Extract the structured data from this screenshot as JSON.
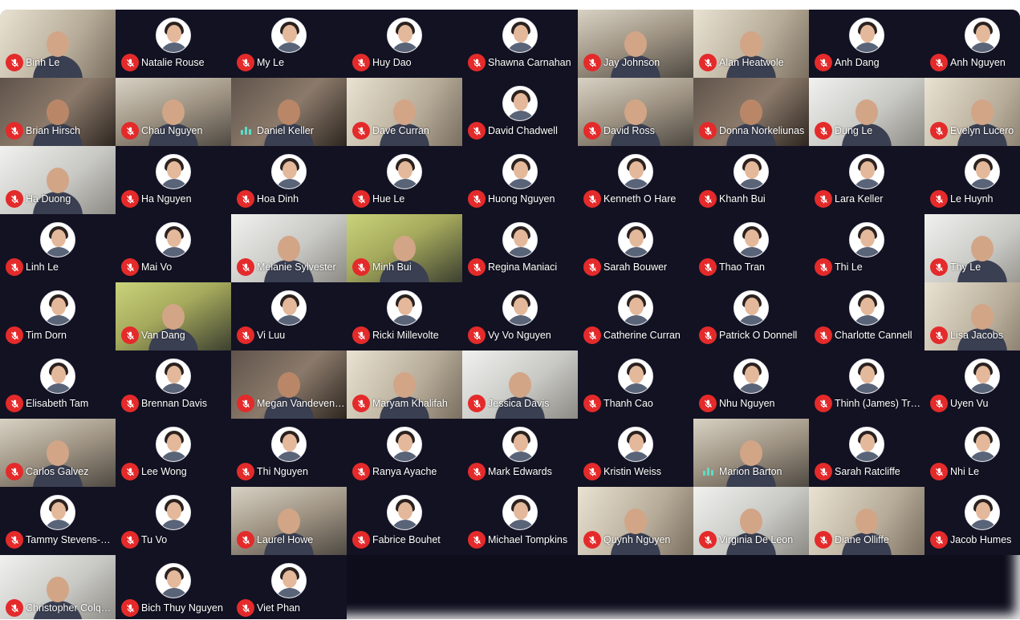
{
  "participants": [
    {
      "name": "Binh Le",
      "video": true,
      "style": "alt2",
      "speaking": false
    },
    {
      "name": "Natalie Rouse",
      "video": false,
      "speaking": false
    },
    {
      "name": "My Le",
      "video": false,
      "speaking": false
    },
    {
      "name": "Huy Dao",
      "video": false,
      "speaking": false
    },
    {
      "name": "Shawna Carnahan",
      "video": false,
      "speaking": false
    },
    {
      "name": "Jay Johnson",
      "video": true,
      "style": "alt1",
      "speaking": false
    },
    {
      "name": "Alan Heatwole",
      "video": true,
      "style": "alt2",
      "speaking": false
    },
    {
      "name": "Anh Dang",
      "video": false,
      "speaking": false
    },
    {
      "name": "Anh Nguyen",
      "video": false,
      "speaking": false
    },
    {
      "name": "Brian Hirsch",
      "video": true,
      "style": "alt4",
      "speaking": false
    },
    {
      "name": "Chau Nguyen",
      "video": true,
      "style": "alt1",
      "speaking": false
    },
    {
      "name": "Daniel Keller",
      "video": true,
      "style": "alt4",
      "speaking": true
    },
    {
      "name": "Dave Curran",
      "video": true,
      "style": "alt2",
      "speaking": false
    },
    {
      "name": "David Chadwell",
      "video": false,
      "speaking": false
    },
    {
      "name": "David Ross",
      "video": true,
      "style": "alt1",
      "speaking": false
    },
    {
      "name": "Donna Norkeliunas",
      "video": true,
      "style": "alt4",
      "speaking": false
    },
    {
      "name": "Dung Le",
      "video": true,
      "style": "alt5",
      "speaking": false
    },
    {
      "name": "Evelyn Lucero",
      "video": true,
      "style": "alt2",
      "speaking": false
    },
    {
      "name": "Ha Duong",
      "video": true,
      "style": "alt5",
      "speaking": false
    },
    {
      "name": "Ha Nguyen",
      "video": false,
      "speaking": false
    },
    {
      "name": "Hoa Dinh",
      "video": false,
      "speaking": false
    },
    {
      "name": "Hue Le",
      "video": false,
      "speaking": false
    },
    {
      "name": "Huong Nguyen",
      "video": false,
      "speaking": false
    },
    {
      "name": "Kenneth O Hare",
      "video": false,
      "speaking": false
    },
    {
      "name": "Khanh Bui",
      "video": false,
      "speaking": false
    },
    {
      "name": "Lara Keller",
      "video": false,
      "speaking": false
    },
    {
      "name": "Le Huynh",
      "video": false,
      "speaking": false
    },
    {
      "name": "Linh Le",
      "video": false,
      "speaking": false
    },
    {
      "name": "Mai Vo",
      "video": false,
      "speaking": false
    },
    {
      "name": "Melanie Sylvester",
      "video": true,
      "style": "alt5",
      "speaking": false
    },
    {
      "name": "Minh Bui",
      "video": true,
      "style": "alt3",
      "speaking": false
    },
    {
      "name": "Regina Maniaci",
      "video": false,
      "speaking": false
    },
    {
      "name": "Sarah Bouwer",
      "video": false,
      "speaking": false
    },
    {
      "name": "Thao Tran",
      "video": false,
      "speaking": false
    },
    {
      "name": "Thi Le",
      "video": false,
      "speaking": false
    },
    {
      "name": "Thy Le",
      "video": true,
      "style": "alt5",
      "speaking": false
    },
    {
      "name": "Tim Dorn",
      "video": false,
      "speaking": false
    },
    {
      "name": "Van Dang",
      "video": true,
      "style": "alt3",
      "speaking": false
    },
    {
      "name": "Vi Luu",
      "video": false,
      "speaking": false
    },
    {
      "name": "Ricki Millevolte",
      "video": false,
      "speaking": false
    },
    {
      "name": "Vy Vo Nguyen",
      "video": false,
      "speaking": false
    },
    {
      "name": "Catherine Curran",
      "video": false,
      "speaking": false
    },
    {
      "name": "Patrick O Donnell",
      "video": false,
      "speaking": false
    },
    {
      "name": "Charlotte Cannell",
      "video": false,
      "speaking": false
    },
    {
      "name": "Lisa Jacobs",
      "video": true,
      "style": "alt2",
      "speaking": false
    },
    {
      "name": "Elisabeth Tam",
      "video": false,
      "speaking": false
    },
    {
      "name": "Brennan Davis",
      "video": false,
      "speaking": false
    },
    {
      "name": "Megan Vandeventer",
      "video": true,
      "style": "alt4",
      "speaking": false
    },
    {
      "name": "Maryam Khalifah",
      "video": true,
      "style": "alt2",
      "speaking": false
    },
    {
      "name": "Jessica Davis",
      "video": true,
      "style": "alt5",
      "speaking": false
    },
    {
      "name": "Thanh Cao",
      "video": false,
      "speaking": false
    },
    {
      "name": "Nhu Nguyen",
      "video": false,
      "speaking": false
    },
    {
      "name": "Thinh (James) Truong",
      "video": false,
      "speaking": false
    },
    {
      "name": "Uyen Vu",
      "video": false,
      "speaking": false
    },
    {
      "name": "Carlos Galvez",
      "video": true,
      "style": "alt1",
      "speaking": false
    },
    {
      "name": "Lee Wong",
      "video": false,
      "speaking": false
    },
    {
      "name": "Thi Nguyen",
      "video": false,
      "speaking": false
    },
    {
      "name": "Ranya Ayache",
      "video": false,
      "speaking": false
    },
    {
      "name": "Mark Edwards",
      "video": false,
      "speaking": false
    },
    {
      "name": "Kristin Weiss",
      "video": false,
      "speaking": false
    },
    {
      "name": "Marion Barton",
      "video": true,
      "style": "alt1",
      "speaking": true
    },
    {
      "name": "Sarah Ratcliffe",
      "video": false,
      "speaking": false
    },
    {
      "name": "Nhi Le",
      "video": false,
      "speaking": false
    },
    {
      "name": "Tammy Stevens-Pearson",
      "video": false,
      "speaking": false
    },
    {
      "name": "Tu Vo",
      "video": false,
      "speaking": false
    },
    {
      "name": "Laurel Howe",
      "video": true,
      "style": "alt1",
      "speaking": false
    },
    {
      "name": "Fabrice Bouhet",
      "video": false,
      "speaking": false
    },
    {
      "name": "Michael Tompkins",
      "video": false,
      "speaking": false
    },
    {
      "name": "Quynh Nguyen",
      "video": true,
      "style": "alt2",
      "speaking": false
    },
    {
      "name": "Virginia De Leon",
      "video": true,
      "style": "alt5",
      "speaking": false
    },
    {
      "name": "Diane Olliffe",
      "video": true,
      "style": "alt2",
      "speaking": false
    },
    {
      "name": "Jacob Humes",
      "video": false,
      "speaking": false
    },
    {
      "name": "Christopher Colquhoun",
      "video": true,
      "style": "alt5",
      "speaking": false
    },
    {
      "name": "Bich Thuy Nguyen",
      "video": false,
      "speaking": false
    },
    {
      "name": "Viet Phan",
      "video": false,
      "speaking": false
    }
  ],
  "colors": {
    "mute_badge": "#e42a2a",
    "grid_background": "#0d0d1c",
    "speaking_indicator": "#58e0c8"
  },
  "icons": {
    "mute": "mic-muted-icon",
    "speaking": "audio-level-icon"
  }
}
